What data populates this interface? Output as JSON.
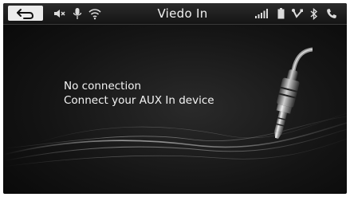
{
  "statusbar": {
    "title": "Viedo In",
    "left_icons": [
      "back-arrow-icon",
      "mute-icon",
      "microphone-icon",
      "wifi-icon"
    ],
    "right_icons": [
      "signal-bars-icon",
      "battery-icon",
      "usb-icon",
      "bluetooth-icon",
      "phone-icon"
    ]
  },
  "main": {
    "line1": "No connection",
    "line2": "Connect your AUX In device"
  },
  "colors": {
    "background": "#0f0f0f",
    "text": "#f4f4f4",
    "back_button_bg": "#ececec"
  }
}
